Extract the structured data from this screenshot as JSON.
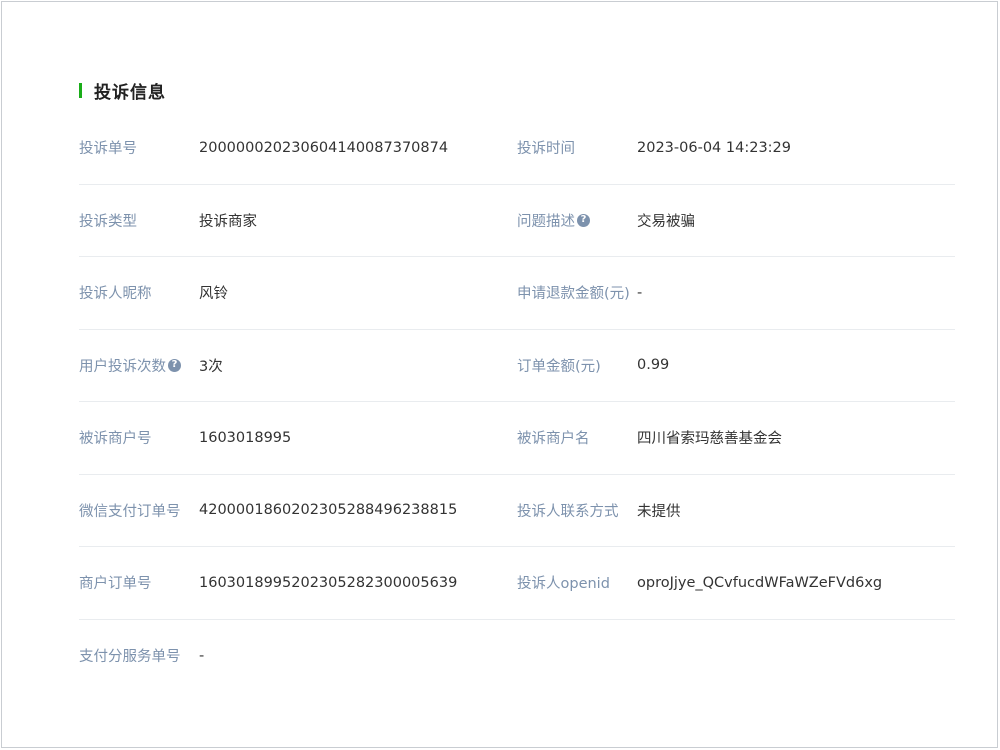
{
  "section": {
    "title": "投诉信息"
  },
  "rows": [
    {
      "left": {
        "label": "投诉单号",
        "value": "200000020230604140087370874"
      },
      "right": {
        "label": "投诉时间",
        "value": "2023-06-04 14:23:29"
      }
    },
    {
      "left": {
        "label": "投诉类型",
        "value": "投诉商家"
      },
      "right": {
        "label": "问题描述",
        "value": "交易被骗",
        "help_icon": "question-mark-icon"
      }
    },
    {
      "left": {
        "label": "投诉人昵称",
        "value": "风铃"
      },
      "right": {
        "label": "申请退款金额(元)",
        "value": "-"
      }
    },
    {
      "left": {
        "label": "用户投诉次数",
        "value": "3次",
        "help_icon": "question-mark-icon"
      },
      "right": {
        "label": "订单金额(元)",
        "value": "0.99"
      }
    },
    {
      "left": {
        "label": "被诉商户号",
        "value": "1603018995"
      },
      "right": {
        "label": "被诉商户名",
        "value": "四川省索玛慈善基金会"
      }
    },
    {
      "left": {
        "label": "微信支付订单号",
        "value": "4200001860202305288496238815"
      },
      "right": {
        "label": "投诉人联系方式",
        "value": "未提供"
      }
    },
    {
      "left": {
        "label": "商户订单号",
        "value": "16030189952023052823000056​39"
      },
      "right": {
        "label": "投诉人openid",
        "value": "oproJjye_QCvfucdWFaWZeFVd6xg"
      }
    },
    {
      "left": {
        "label": "支付分服务单号",
        "value": "-"
      }
    }
  ],
  "colors": {
    "accent": "#1aad19",
    "label": "#7d92ad",
    "value": "#333333",
    "divider": "#e9ecef"
  }
}
